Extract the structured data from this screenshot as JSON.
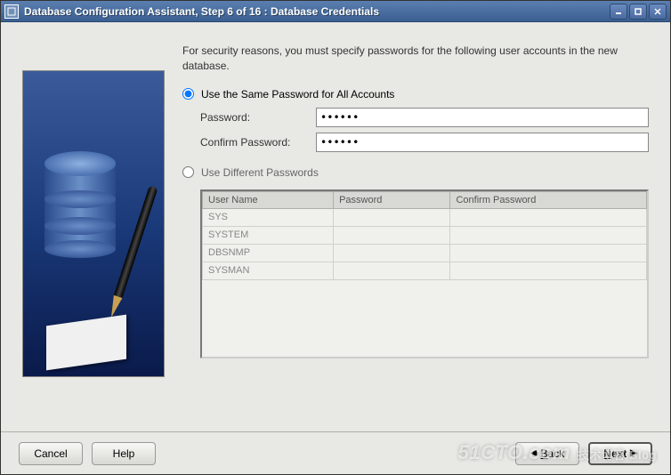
{
  "window": {
    "title": "Database Configuration Assistant, Step 6 of 16 : Database Credentials"
  },
  "intro": "For security reasons, you must specify passwords for the following user accounts in the new database.",
  "same_pw": {
    "radio_label": "Use the Same Password for All Accounts",
    "password_label": "Password:",
    "confirm_label": "Confirm Password:",
    "password_value": "******",
    "confirm_value": "******"
  },
  "diff_pw": {
    "radio_label": "Use Different Passwords",
    "columns": {
      "user": "User Name",
      "pw": "Password",
      "confirm": "Confirm Password"
    },
    "rows": [
      {
        "user": "SYS",
        "pw": "",
        "confirm": ""
      },
      {
        "user": "SYSTEM",
        "pw": "",
        "confirm": ""
      },
      {
        "user": "DBSNMP",
        "pw": "",
        "confirm": ""
      },
      {
        "user": "SYSMAN",
        "pw": "",
        "confirm": ""
      }
    ]
  },
  "buttons": {
    "cancel": "Cancel",
    "help": "Help",
    "back": "Back",
    "next": "Next"
  },
  "watermark": {
    "main": "51CTO.com",
    "sub": "技术博客   Blog"
  }
}
